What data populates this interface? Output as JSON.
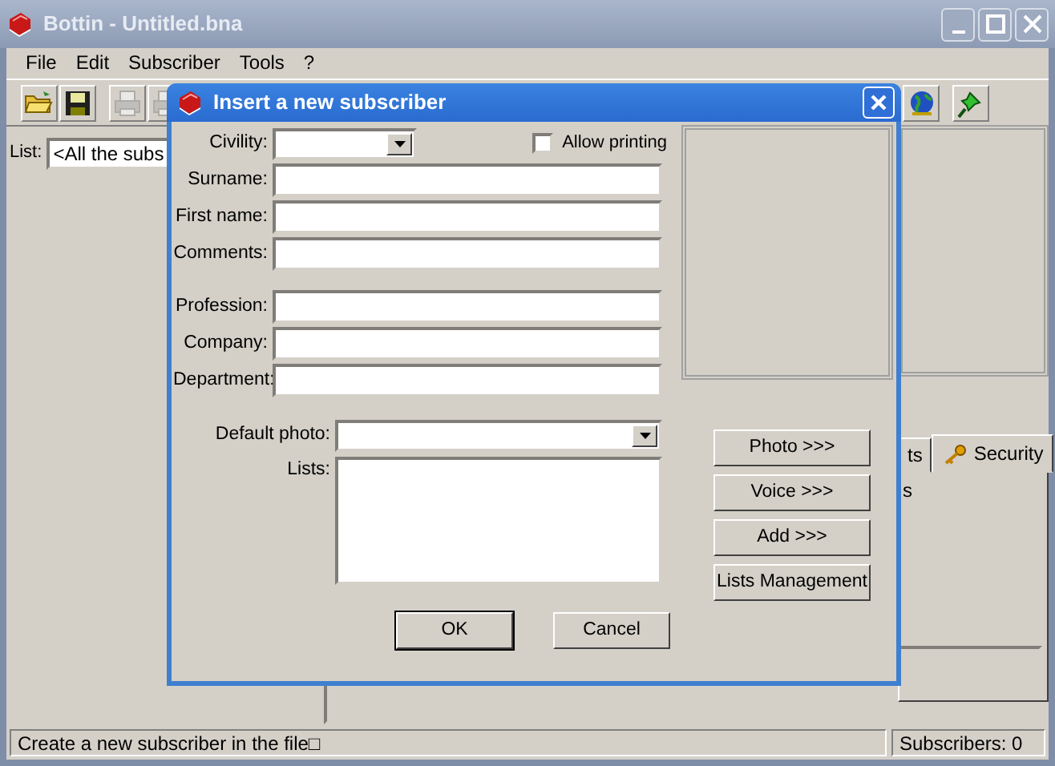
{
  "window": {
    "title": "Bottin - Untitled.bna"
  },
  "menu": [
    "File",
    "Edit",
    "Subscriber",
    "Tools",
    "?"
  ],
  "toolbar": [
    {
      "disabled": false
    },
    {
      "disabled": false
    },
    {
      "disabled": true
    },
    {
      "disabled": true
    },
    {
      "disabled": false
    },
    {
      "disabled": false
    }
  ],
  "list_filter": {
    "label": "List:",
    "value": "<All the subs"
  },
  "tabs": [
    {
      "label": "ts",
      "selected": false
    },
    {
      "label": "Security",
      "selected": true
    }
  ],
  "tab_panel_text": "s",
  "status_bar": {
    "message": "Create a new subscriber in the file□",
    "count": "Subscribers: 0"
  },
  "dialog": {
    "title": "Insert a new subscriber",
    "civility": {
      "label": "Civility:"
    },
    "allow_printing": {
      "label": "Allow printing",
      "checked": false
    },
    "fields": [
      {
        "label": "Surname:"
      },
      {
        "label": "First name:"
      },
      {
        "label": "Comments:"
      }
    ],
    "fields_2": [
      {
        "label": "Profession:"
      },
      {
        "label": "Company:"
      },
      {
        "label": "Department:"
      }
    ],
    "default_photo": {
      "label": "Default photo:"
    },
    "lists": {
      "label": "Lists:"
    },
    "side_buttons": [
      "Photo >>>",
      "Voice >>>",
      "Add >>>",
      "Lists Management"
    ],
    "buttons": [
      {
        "label": "OK",
        "default": true
      },
      {
        "label": "Cancel",
        "default": false
      }
    ]
  }
}
